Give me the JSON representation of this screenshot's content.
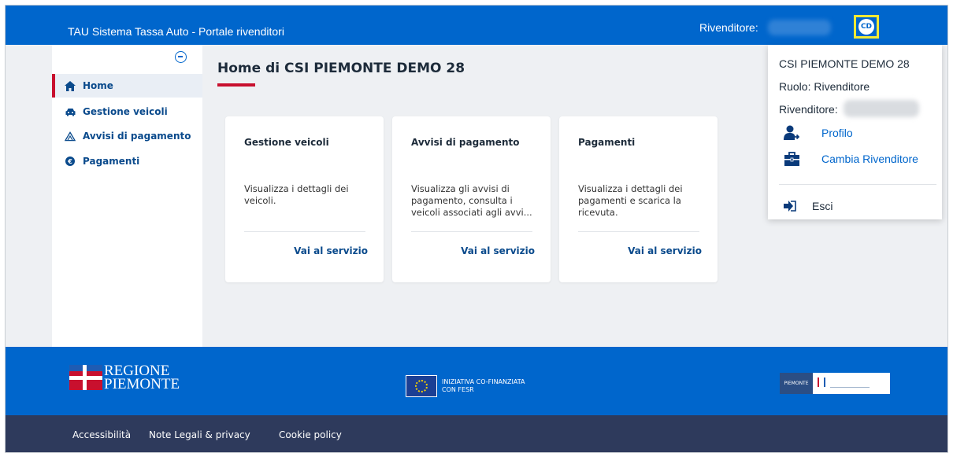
{
  "header": {
    "app_title": "TAU Sistema Tassa Auto - Portale rivenditori",
    "dealer_label": "Rivenditore:",
    "avatar_initials": "CD",
    "brand_color": "#0066cc"
  },
  "sidebar": {
    "items": [
      {
        "label": "Home",
        "icon": "home-icon",
        "active": true
      },
      {
        "label": "Gestione veicoli",
        "icon": "car-icon",
        "active": false
      },
      {
        "label": "Avvisi di pagamento",
        "icon": "warning-icon",
        "active": false
      },
      {
        "label": "Pagamenti",
        "icon": "euro-icon",
        "active": false
      }
    ]
  },
  "main": {
    "title": "Home di CSI PIEMONTE DEMO 28",
    "cards": [
      {
        "title": "Gestione veicoli",
        "description": "Visualizza i dettagli dei veicoli.",
        "link": "Vai al servizio"
      },
      {
        "title": "Avvisi di pagamento",
        "description": "Visualizza gli avvisi di pagamento, consulta i veicoli associati agli avvi...",
        "link": "Vai al servizio"
      },
      {
        "title": "Pagamenti",
        "description": "Visualizza i dettagli dei pagamenti e scarica la ricevuta.",
        "link": "Vai al servizio"
      }
    ]
  },
  "user_menu": {
    "name": "CSI PIEMONTE DEMO 28",
    "role": "Ruolo: Rivenditore",
    "dealer_label": "Rivenditore:",
    "profile": "Profilo",
    "change_dealer": "Cambia Rivenditore",
    "logout": "Esci"
  },
  "footer": {
    "regione_line1": "REGIONE",
    "regione_line2": "PIEMONTE",
    "eu_line1": "INIZIATIVA CO-FINANZIATA",
    "eu_line2": "CON FESR",
    "partner_text": "PIEMONTE",
    "links": [
      "Accessibilità",
      "Note Legali & privacy",
      "Cookie policy"
    ]
  }
}
